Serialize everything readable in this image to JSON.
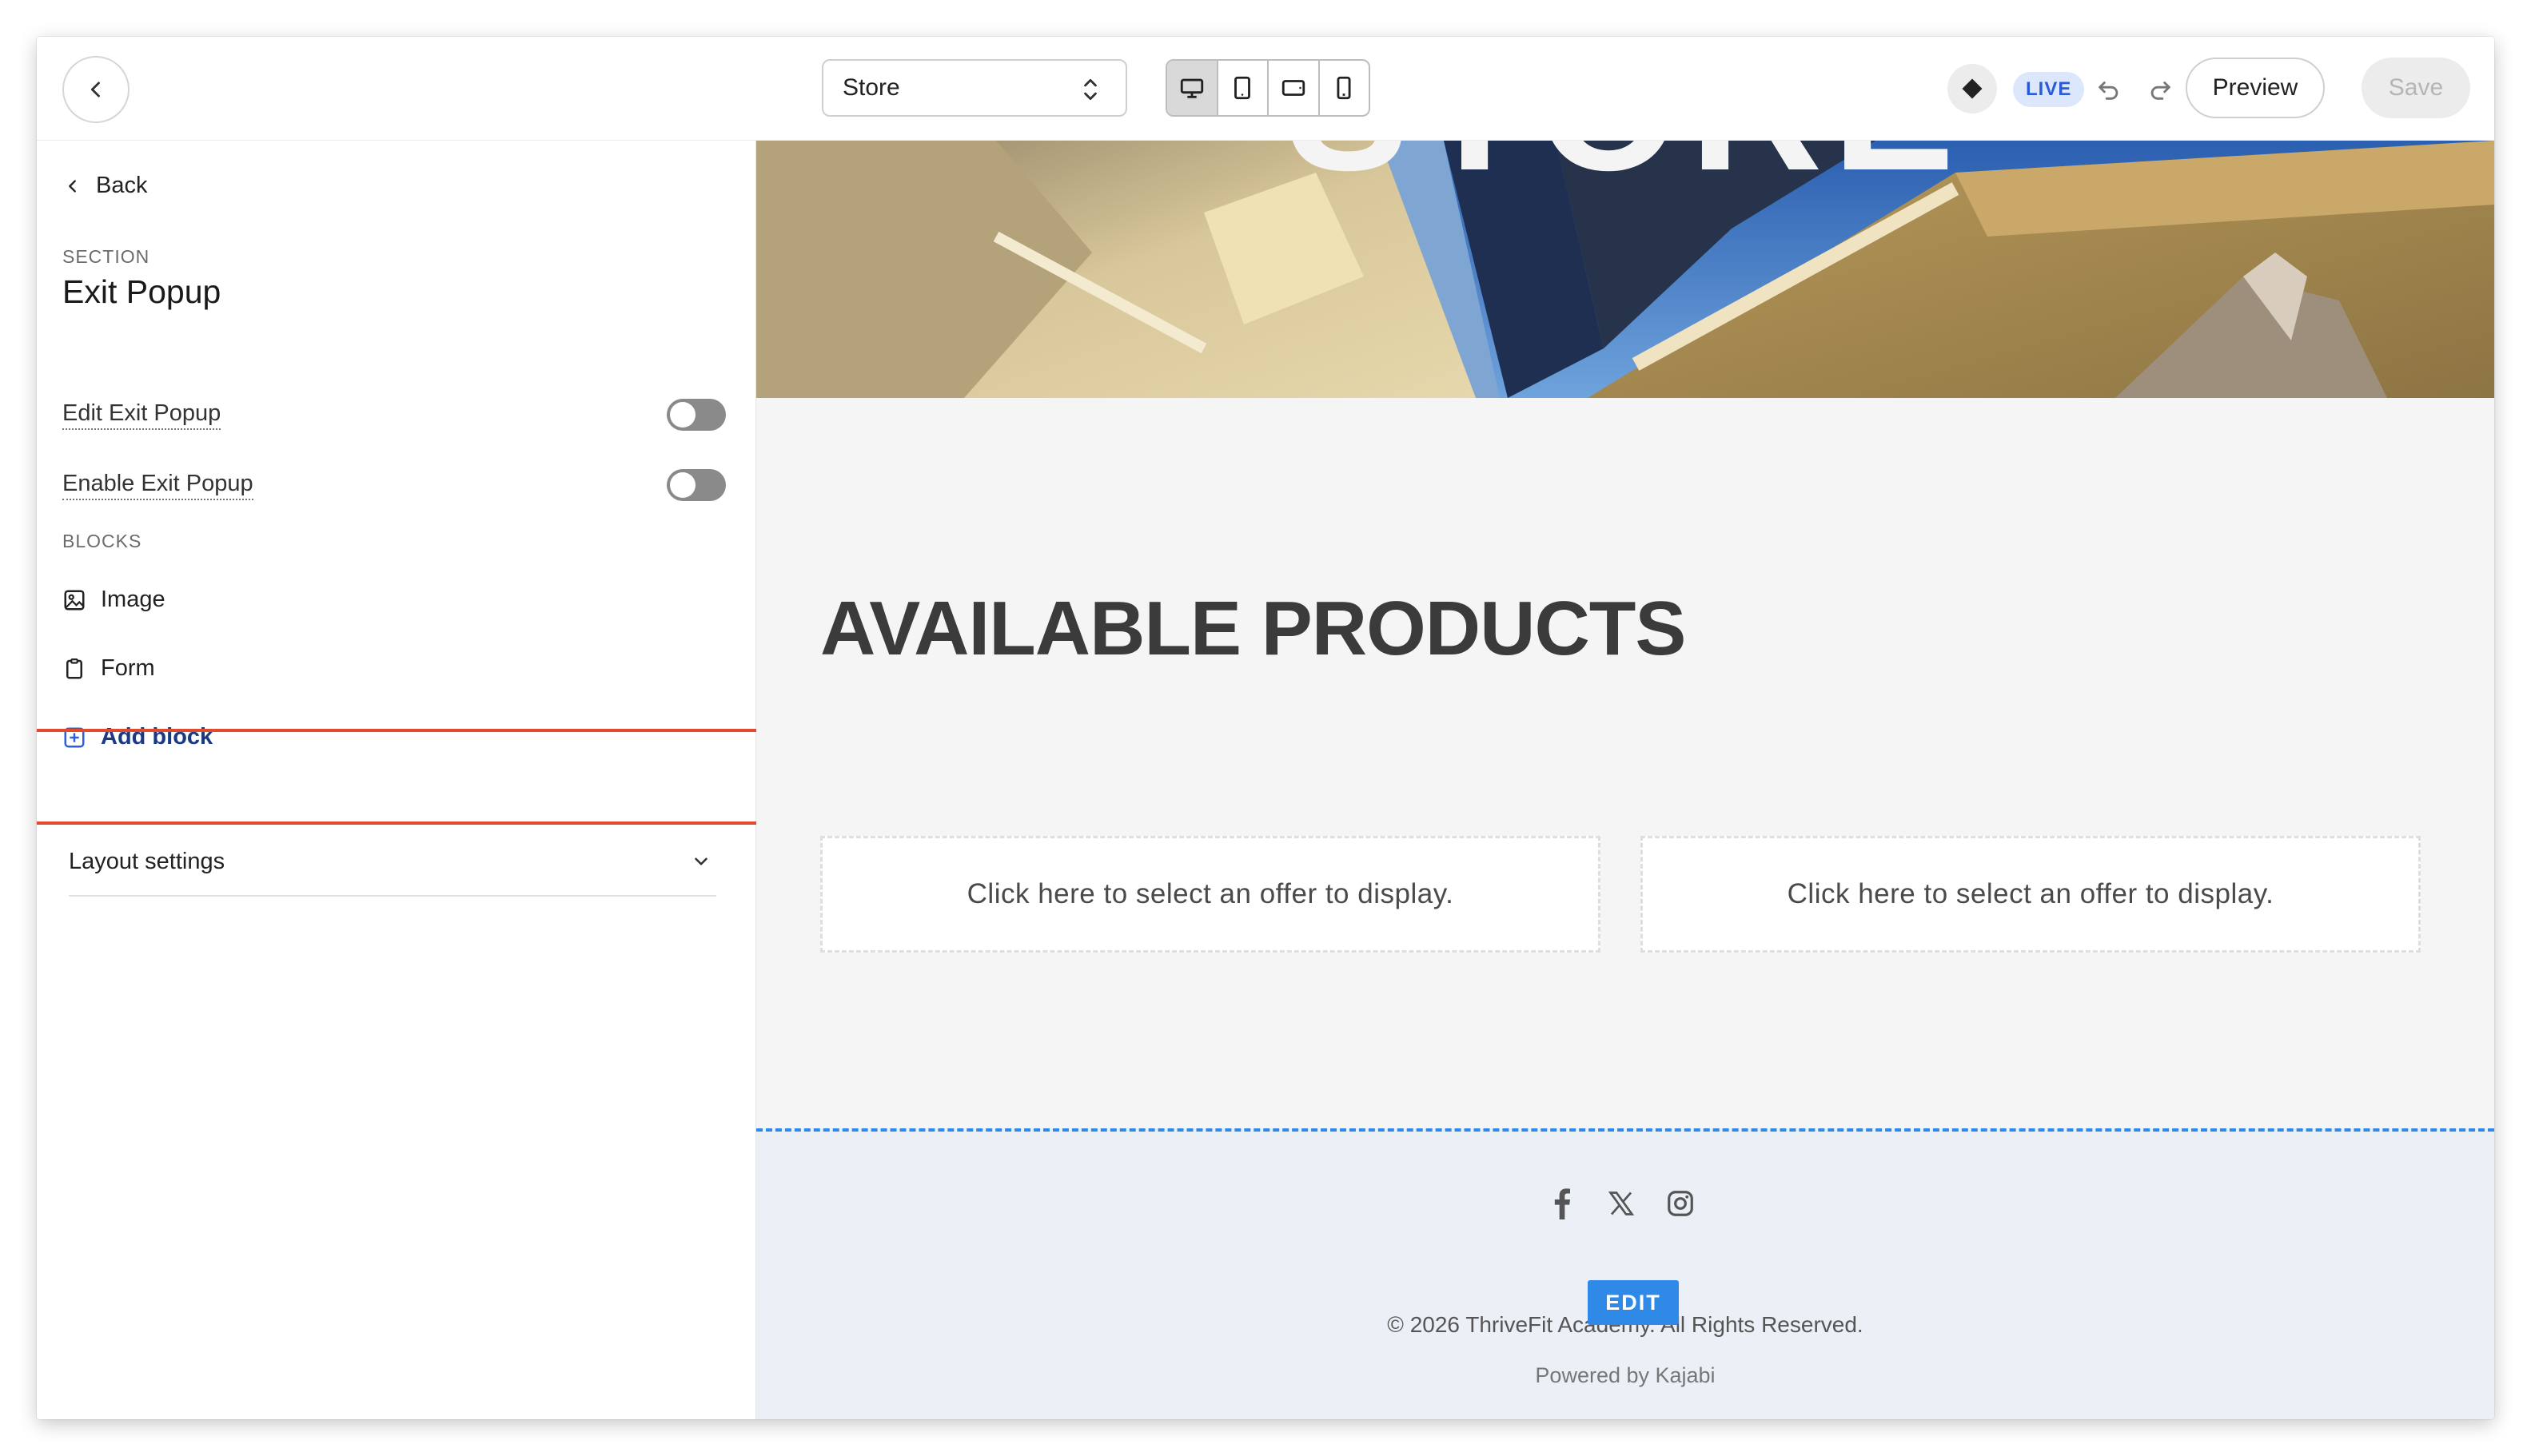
{
  "topbar": {
    "page_select_value": "Store",
    "live_label": "LIVE",
    "preview_label": "Preview",
    "save_label": "Save"
  },
  "sidebar": {
    "back_label": "Back",
    "section_label": "SECTION",
    "section_title": "Exit Popup",
    "toggles": [
      {
        "label": "Edit Exit Popup",
        "on": false
      },
      {
        "label": "Enable Exit Popup",
        "on": false
      }
    ],
    "blocks_label": "BLOCKS",
    "blocks": [
      {
        "label": "Image",
        "icon": "image-icon"
      },
      {
        "label": "Form",
        "icon": "clipboard-icon"
      }
    ],
    "add_block_label": "Add block",
    "layout_settings_label": "Layout settings"
  },
  "canvas": {
    "hero_title": "STORE",
    "products_heading": "AVAILABLE PRODUCTS",
    "offer_cards": [
      "Click here to select an offer to display.",
      "Click here to select an offer to display."
    ],
    "footer": {
      "edit_badge": "EDIT",
      "copyright": "© 2026 ThriveFit Academy. All Rights Reserved.",
      "powered_by": "Powered by Kajabi",
      "social_icons": [
        "facebook-icon",
        "x-icon",
        "instagram-icon"
      ]
    }
  },
  "colors": {
    "accent_blue": "#2e8ae6",
    "highlight_red": "#e24a2e",
    "live_text": "#2a5bd7",
    "add_block_text": "#1b3a82"
  }
}
